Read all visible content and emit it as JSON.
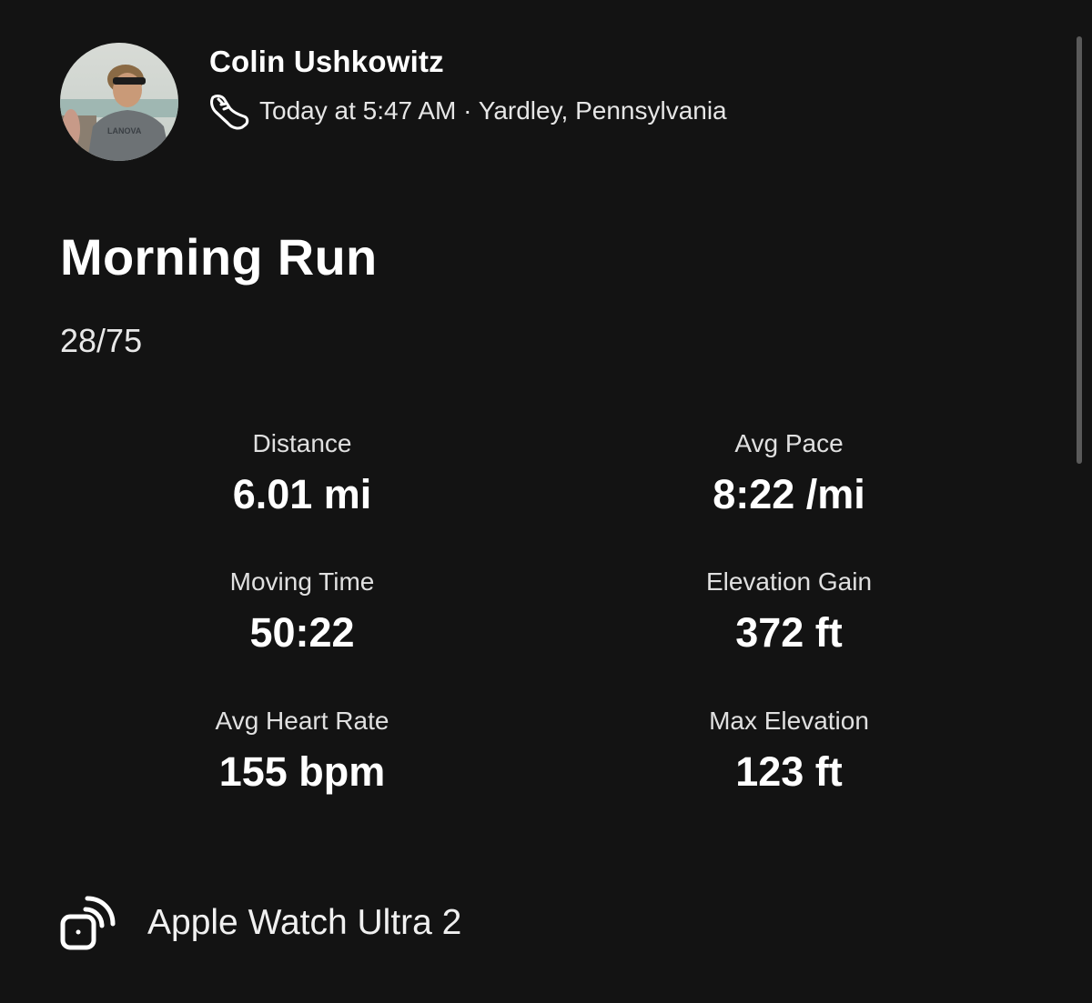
{
  "athlete": {
    "name": "Colin Ushkowitz",
    "meta": "Today at 5:47 AM · Yardley, Pennsylvania",
    "activity_icon": "running-shoe-icon"
  },
  "activity": {
    "title": "Morning Run",
    "description": "28/75"
  },
  "stats": [
    {
      "label": "Distance",
      "value": "6.01 mi"
    },
    {
      "label": "Avg Pace",
      "value": "8:22 /mi"
    },
    {
      "label": "Moving Time",
      "value": "50:22"
    },
    {
      "label": "Elevation Gain",
      "value": "372 ft"
    },
    {
      "label": "Avg Heart Rate",
      "value": "155 bpm"
    },
    {
      "label": "Max Elevation",
      "value": "123 ft"
    }
  ],
  "device": {
    "icon": "connected-device-icon",
    "name": "Apple Watch Ultra 2"
  },
  "colors": {
    "background": "#131313",
    "text_primary": "#ffffff",
    "scrollbar": "#5a5a5a"
  }
}
